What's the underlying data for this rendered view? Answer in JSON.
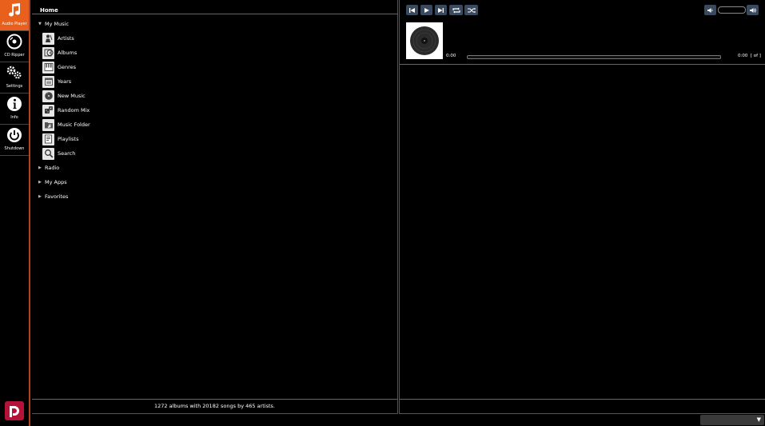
{
  "sidebar": {
    "apps": [
      {
        "label": "Audio Player",
        "icon": "music-note-icon",
        "active": true
      },
      {
        "label": "CD Ripper",
        "icon": "disc-icon",
        "active": false
      },
      {
        "label": "Settings",
        "icon": "gears-icon",
        "active": false
      },
      {
        "label": "Info",
        "icon": "info-icon",
        "active": false
      },
      {
        "label": "Shutdown",
        "icon": "power-icon",
        "active": false
      }
    ],
    "brand_logo_text": "D"
  },
  "library": {
    "title": "Home",
    "my_music": {
      "label": "My Music",
      "items": [
        {
          "label": "Artists",
          "icon": "artist-icon"
        },
        {
          "label": "Albums",
          "icon": "album-icon"
        },
        {
          "label": "Genres",
          "icon": "genre-icon"
        },
        {
          "label": "Years",
          "icon": "calendar-icon"
        },
        {
          "label": "New Music",
          "icon": "new-music-icon"
        },
        {
          "label": "Random Mix",
          "icon": "dice-icon"
        },
        {
          "label": "Music Folder",
          "icon": "folder-icon"
        },
        {
          "label": "Playlists",
          "icon": "playlist-icon"
        },
        {
          "label": "Search",
          "icon": "search-icon"
        }
      ]
    },
    "nodes": [
      "Radio",
      "My Apps",
      "Favorites"
    ],
    "status": "1272 albums with 20182 songs by 465 artists."
  },
  "player": {
    "controls": [
      "previous-icon",
      "play-icon",
      "next-icon",
      "repeat-icon",
      "shuffle-icon"
    ],
    "elapsed": "0:00",
    "total": "0:00",
    "track_pos": "[ of ]",
    "progress": 0,
    "volume_icons": [
      "volume-down-icon",
      "volume-up-icon"
    ]
  },
  "colors": {
    "accent": "#e8601c",
    "sidebar_border": "#b3411f",
    "control_bg": "#3a4a5e",
    "brand": "#b5123a"
  }
}
